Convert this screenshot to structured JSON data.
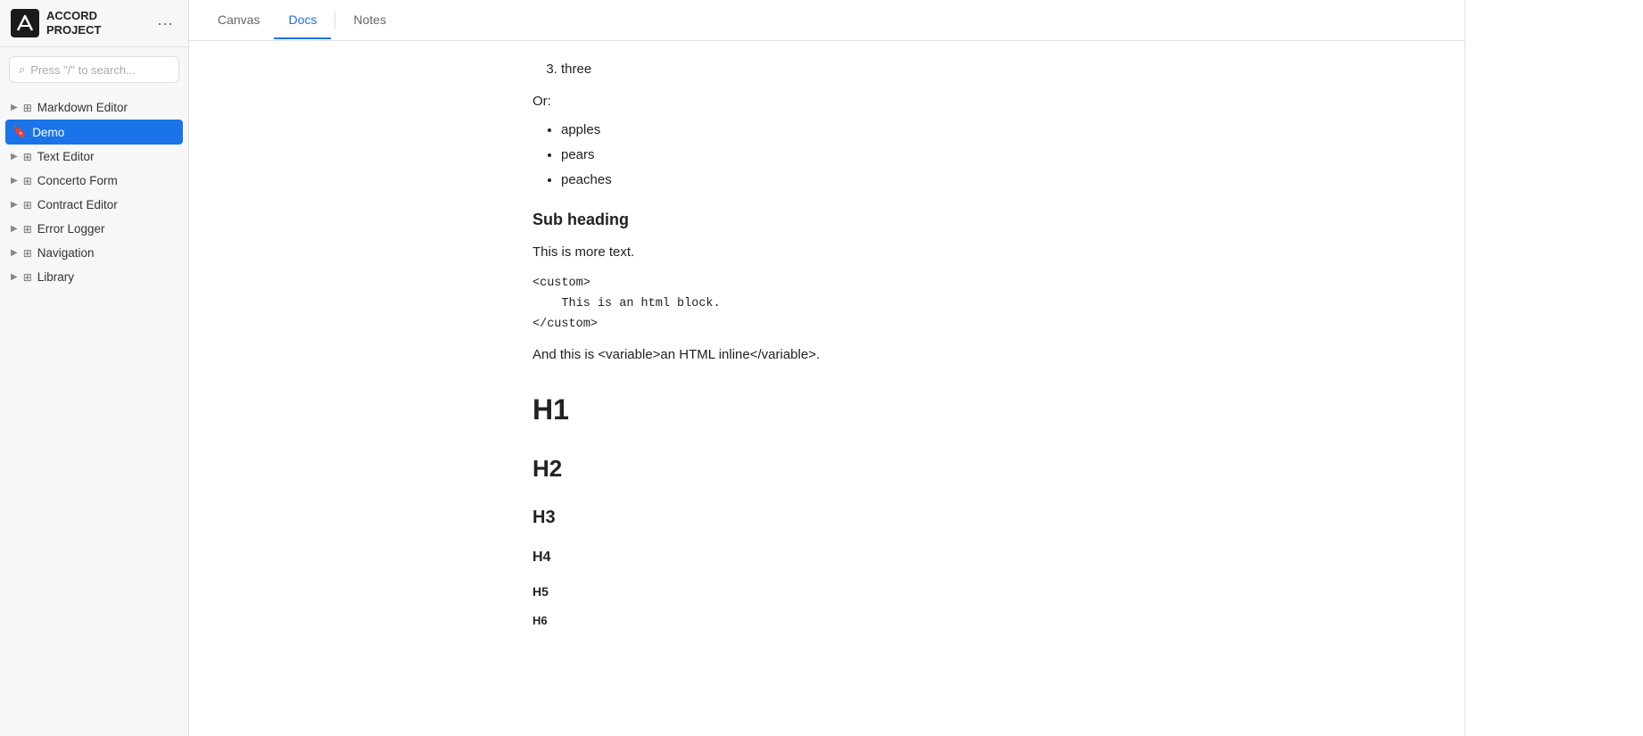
{
  "app": {
    "logo_line1": "ACCORD",
    "logo_line2": "PROJECT"
  },
  "sidebar": {
    "search_placeholder": "Press \"/\" to search...",
    "items": [
      {
        "id": "markdown-editor",
        "label": "Markdown Editor",
        "active": false,
        "sub": false
      },
      {
        "id": "demo",
        "label": "Demo",
        "active": true,
        "sub": true
      },
      {
        "id": "text-editor",
        "label": "Text Editor",
        "active": false,
        "sub": false
      },
      {
        "id": "concerto-form",
        "label": "Concerto Form",
        "active": false,
        "sub": false
      },
      {
        "id": "contract-editor",
        "label": "Contract Editor",
        "active": false,
        "sub": false
      },
      {
        "id": "error-logger",
        "label": "Error Logger",
        "active": false,
        "sub": false
      },
      {
        "id": "navigation",
        "label": "Navigation",
        "active": false,
        "sub": false
      },
      {
        "id": "library",
        "label": "Library",
        "active": false,
        "sub": false
      }
    ]
  },
  "tabs": [
    {
      "id": "canvas",
      "label": "Canvas",
      "active": false
    },
    {
      "id": "docs",
      "label": "Docs",
      "active": true
    },
    {
      "id": "notes",
      "label": "Notes",
      "active": false
    }
  ],
  "document": {
    "ordered_list_items": [
      "three"
    ],
    "or_text": "Or:",
    "bullet_list_items": [
      "apples",
      "pears",
      "peaches"
    ],
    "subheading": "Sub heading",
    "paragraph1": "This is more text.",
    "code_block": "<custom>\nThis is an html block.\n</custom>",
    "inline_html_text": "And this is <variable>an HTML inline</variable>.",
    "h1": "H1",
    "h2": "H2",
    "h3": "H3",
    "h4": "H4",
    "h5": "H5",
    "h6": "H6"
  },
  "icons": {
    "search": "🔍",
    "more": "···",
    "expand": "▶",
    "bookmark": "🔖",
    "grid": "⊞"
  }
}
